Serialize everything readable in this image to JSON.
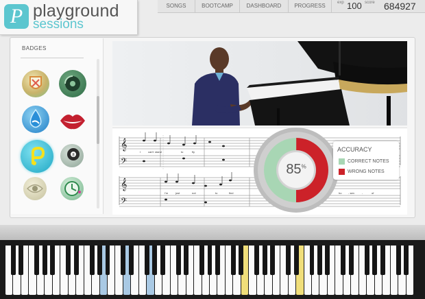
{
  "brand": {
    "line1": "playground",
    "line2": "sessions",
    "mark": "P"
  },
  "nav": {
    "items": [
      "SONGS",
      "BOOTCAMP",
      "DASHBOARD",
      "PROGRESS"
    ]
  },
  "stats": {
    "exp_label": "exp",
    "exp_value": "100",
    "score_label": "score",
    "score_value": "684927"
  },
  "badges": {
    "title": "BADGES",
    "items": [
      "crest-badge",
      "vinyl-badge",
      "water-drop-badge",
      "lips-badge",
      "logo-badge",
      "eight-ball-badge",
      "eye-badge",
      "clock-badge"
    ]
  },
  "sheet": {
    "lyrics_row1": [
      "I",
      "can't",
      "stand",
      "to",
      "fly"
    ],
    "lyrics_row2": [
      "I'm",
      "just",
      "not",
      "to",
      "find"
    ],
    "lyrics_row2b": [
      "ho",
      "- sen",
      "-",
      "of"
    ]
  },
  "accuracy": {
    "title": "ACCURACY",
    "percent": 85,
    "percent_label": "85",
    "percent_sign": "%",
    "correct_label": "CORRECT NOTES",
    "wrong_label": "WRONG NOTES",
    "correct_color": "#a8d6b4",
    "wrong_color": "#cc2229"
  }
}
